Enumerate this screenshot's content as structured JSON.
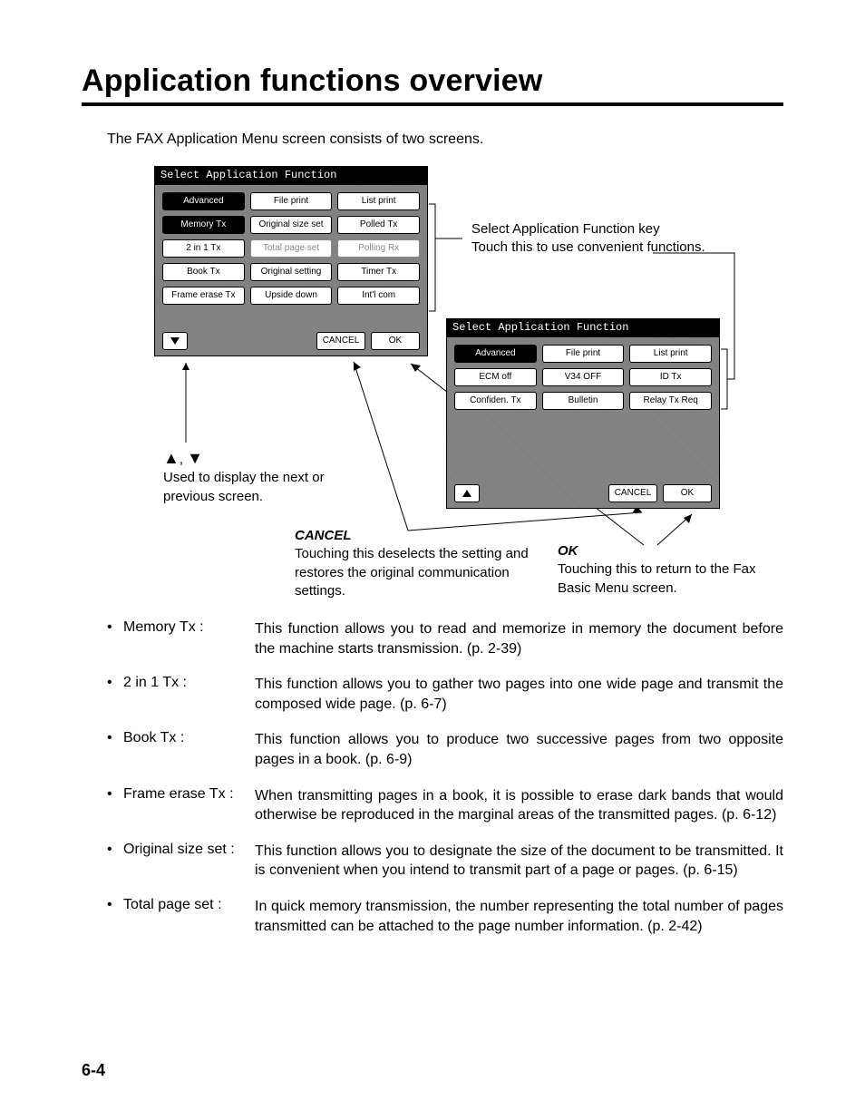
{
  "title": "Application functions overview",
  "intro": "The FAX Application Menu screen consists of two screens.",
  "panel_title": "Select Application Function",
  "panel1": {
    "rows": [
      [
        {
          "label": "Advanced",
          "style": "inverted"
        },
        {
          "label": "File print"
        },
        {
          "label": "List print"
        }
      ],
      [
        {
          "label": "Memory Tx",
          "style": "inverted"
        },
        {
          "label": "Original size set"
        },
        {
          "label": "Polled Tx"
        }
      ],
      [
        {
          "label": "2 in 1 Tx"
        },
        {
          "label": "Total page set",
          "style": "dim"
        },
        {
          "label": "Polling Rx",
          "style": "dim"
        }
      ],
      [
        {
          "label": "Book Tx"
        },
        {
          "label": "Original setting"
        },
        {
          "label": "Timer Tx"
        }
      ],
      [
        {
          "label": "Frame erase Tx"
        },
        {
          "label": "Upside down"
        },
        {
          "label": "Int'l com"
        }
      ]
    ],
    "cancel": "CANCEL",
    "ok": "OK"
  },
  "panel2": {
    "rows": [
      [
        {
          "label": "Advanced",
          "style": "inverted"
        },
        {
          "label": "File print"
        },
        {
          "label": "List print"
        }
      ],
      [
        {
          "label": "ECM off"
        },
        {
          "label": "V34 OFF"
        },
        {
          "label": "ID Tx"
        }
      ],
      [
        {
          "label": "Confiden. Tx"
        },
        {
          "label": "Bulletin"
        },
        {
          "label": "Relay Tx Req"
        }
      ]
    ],
    "cancel": "CANCEL",
    "ok": "OK"
  },
  "callouts": {
    "select_key1": "Select Application Function key",
    "select_key2": "Touch this to use convenient functions.",
    "prev_next": "Used to display the next or previous screen.",
    "cancel_label": "CANCEL",
    "cancel_text": "Touching this deselects the setting and restores the original communication settings.",
    "ok_label": "OK",
    "ok_text": "Touching this to return to the Fax Basic Menu screen.",
    "comma": ","
  },
  "bullets": [
    {
      "term": "Memory Tx :",
      "desc": "This function allows you to read and memorize in memory the document before the machine starts transmission. (p. 2-39)"
    },
    {
      "term": "2 in 1 Tx :",
      "desc": "This function allows you to gather two pages into one wide page and transmit the composed wide page. (p. 6-7)"
    },
    {
      "term": "Book Tx :",
      "desc": "This function allows you to produce two successive pages from two opposite pages in a book. (p. 6-9)"
    },
    {
      "term": "Frame erase Tx :",
      "desc": "When transmitting pages in a book, it is possible to erase dark bands that would otherwise be reproduced in the marginal areas of the transmitted pages. (p. 6-12)"
    },
    {
      "term": "Original size set :",
      "desc": "This function allows you to designate the size of the document to be transmitted. It is convenient when you intend to transmit part of a page or pages. (p. 6-15)"
    },
    {
      "term": "Total page set :",
      "desc": "In quick memory transmission, the number representing the total number of pages transmitted can be attached to the page number information. (p. 2-42)"
    }
  ],
  "page_number": "6-4"
}
